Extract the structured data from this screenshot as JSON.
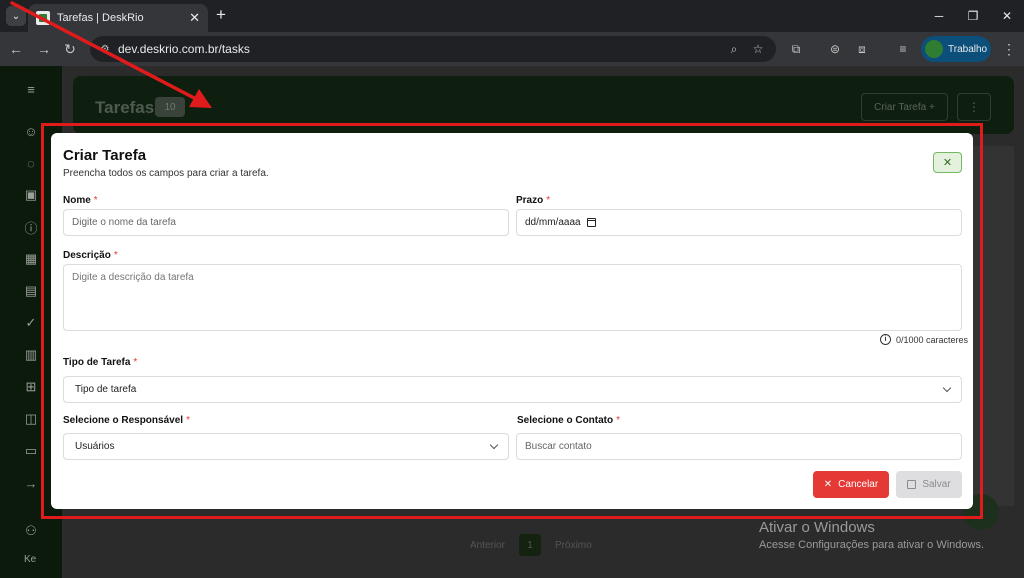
{
  "browser": {
    "tab_title": "Tarefas | DeskRio",
    "url": "dev.deskrio.com.br/tasks",
    "profile_name": "Trabalho"
  },
  "app": {
    "page_title": "Tarefas",
    "task_count": "10",
    "create_button": "Criar Tarefa +",
    "user_initials": "Ke",
    "pagination": {
      "prev": "Anterior",
      "current": "1",
      "next": "Próximo"
    }
  },
  "modal": {
    "title": "Criar Tarefa",
    "subtitle": "Preencha todos os campos para criar a tarefa.",
    "fields": {
      "nome": {
        "label": "Nome",
        "placeholder": "Digite o nome da tarefa"
      },
      "prazo": {
        "label": "Prazo",
        "value": "dd/mm/aaaa"
      },
      "descricao": {
        "label": "Descrição",
        "placeholder": "Digite a descrição da tarefa",
        "counter": "0/1000 caracteres"
      },
      "tipo": {
        "label": "Tipo de Tarefa",
        "value": "Tipo de tarefa"
      },
      "responsavel": {
        "label": "Selecione o Responsável",
        "value": "Usuários"
      },
      "contato": {
        "label": "Selecione o Contato",
        "placeholder": "Buscar contato"
      }
    },
    "required_mark": "*",
    "buttons": {
      "cancel": "Cancelar",
      "save": "Salvar"
    }
  },
  "os_watermark": {
    "title": "Ativar o Windows",
    "subtitle": "Acesse Configurações para ativar o Windows."
  },
  "colors": {
    "highlight": "#e01b1b",
    "cancel": "#e53935",
    "brand_green": "#2e7d32"
  }
}
